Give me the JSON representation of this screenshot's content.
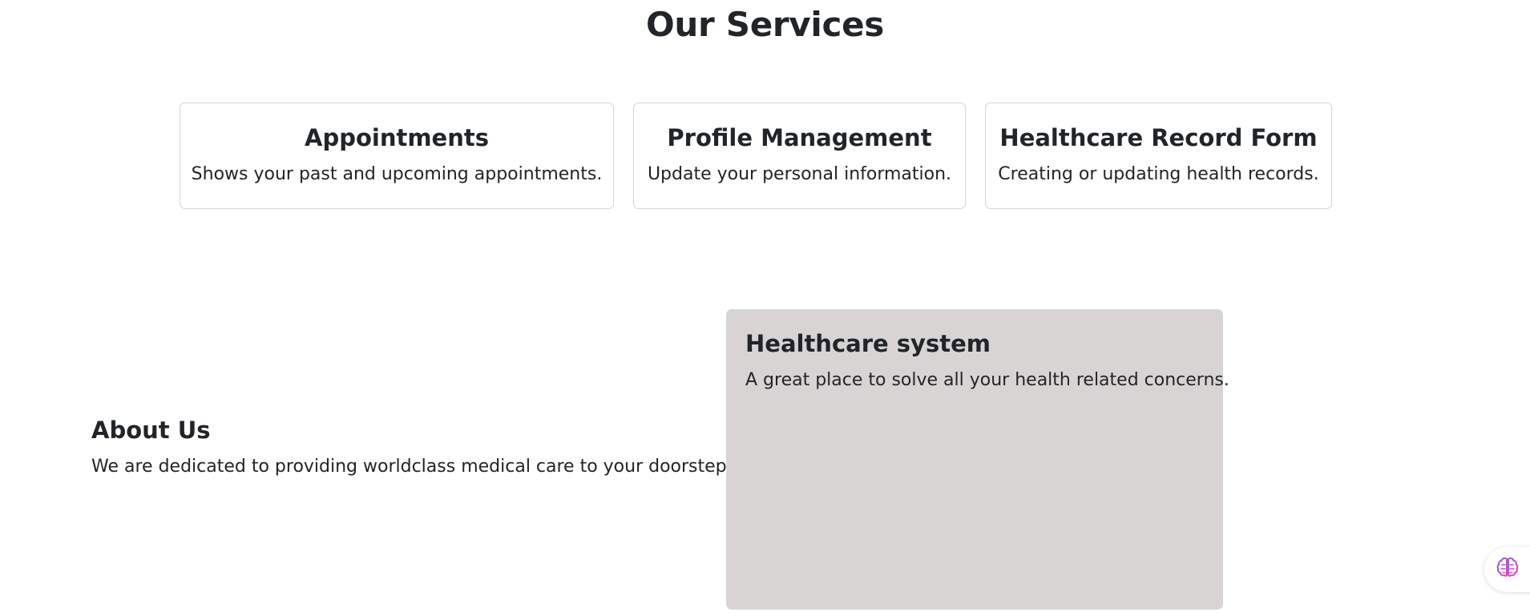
{
  "services": {
    "title": "Our Services",
    "cards": [
      {
        "title": "Appointments",
        "description": "Shows your past and upcoming appointments."
      },
      {
        "title": "Profile Management",
        "description": "Update your personal information."
      },
      {
        "title": "Healthcare Record Form",
        "description": "Creating or updating health records."
      }
    ]
  },
  "about": {
    "title": "About Us",
    "description": "We are dedicated to providing worldclass medical care to your doorstep."
  },
  "hero": {
    "title": "Healthcare system",
    "description": "A great place to solve all your health related concerns."
  },
  "widget": {
    "icon": "brain-icon",
    "colors": [
      "#8b5cf6",
      "#ec4899"
    ]
  },
  "colors": {
    "text": "#212529",
    "card_border": "#d4d4d4",
    "panel_background": "#d8d4d4"
  }
}
